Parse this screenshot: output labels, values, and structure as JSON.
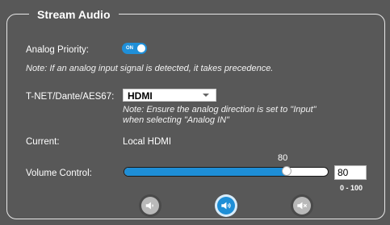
{
  "panel": {
    "title": "Stream Audio"
  },
  "analog_priority": {
    "label": "Analog Priority:",
    "toggle_text": "ON",
    "state": "on",
    "note": "Note: If an analog input signal is detected, it takes precedence."
  },
  "tnet": {
    "label": "T-NET/Dante/AES67:",
    "selected": "HDMI",
    "note_line1": "Note: Ensure the analog direction is set to \"Input\"",
    "note_line2": "when selecting \"Analog IN\""
  },
  "current": {
    "label": "Current:",
    "value": "Local HDMI"
  },
  "volume": {
    "label": "Volume Control:",
    "value": 80,
    "value_text": "80",
    "input_value": "80",
    "range_text": "0 - 100",
    "min": 0,
    "max": 100
  },
  "buttons": {
    "volume_down_icon": "volume-low-icon",
    "volume_up_icon": "volume-high-icon",
    "mute_icon": "volume-mute-icon"
  },
  "colors": {
    "accent": "#1e8ed6",
    "background": "#585858",
    "inactive_button": "#b9b9b9"
  }
}
